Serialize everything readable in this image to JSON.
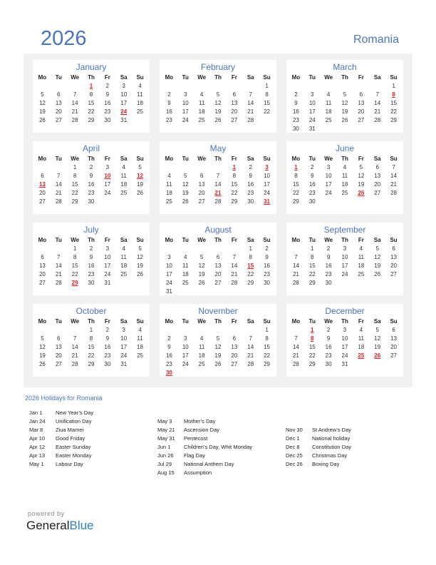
{
  "header": {
    "year": "2026",
    "country": "Romania"
  },
  "weekdays": [
    "Mo",
    "Tu",
    "We",
    "Th",
    "Fr",
    "Sa",
    "Su"
  ],
  "months": [
    {
      "name": "January",
      "offset": 3,
      "days": 31,
      "holidays": [
        1,
        24
      ]
    },
    {
      "name": "February",
      "offset": 6,
      "days": 28,
      "holidays": []
    },
    {
      "name": "March",
      "offset": 6,
      "days": 31,
      "holidays": [
        8
      ]
    },
    {
      "name": "April",
      "offset": 2,
      "days": 30,
      "holidays": [
        10,
        12,
        13
      ]
    },
    {
      "name": "May",
      "offset": 4,
      "days": 31,
      "holidays": [
        1,
        3,
        21,
        31
      ]
    },
    {
      "name": "June",
      "offset": 0,
      "days": 30,
      "holidays": [
        1,
        26
      ]
    },
    {
      "name": "July",
      "offset": 2,
      "days": 31,
      "holidays": [
        29
      ]
    },
    {
      "name": "August",
      "offset": 5,
      "days": 31,
      "holidays": [
        15
      ]
    },
    {
      "name": "September",
      "offset": 1,
      "days": 30,
      "holidays": []
    },
    {
      "name": "October",
      "offset": 3,
      "days": 31,
      "holidays": []
    },
    {
      "name": "November",
      "offset": 6,
      "days": 30,
      "holidays": [
        30
      ]
    },
    {
      "name": "December",
      "offset": 1,
      "days": 31,
      "holidays": [
        1,
        8,
        25,
        26
      ]
    }
  ],
  "holidays_title": "2026 Holidays for Romania",
  "holiday_columns": [
    [
      {
        "date": "Jan 1",
        "name": "New Year’s Day"
      },
      {
        "date": "Jan 24",
        "name": "Unification Day"
      },
      {
        "date": "Mar 8",
        "name": "Ziua Mamei"
      },
      {
        "date": "Apr 10",
        "name": "Good Friday"
      },
      {
        "date": "Apr 12",
        "name": "Easter Sunday"
      },
      {
        "date": "Apr 13",
        "name": "Easter Monday"
      },
      {
        "date": "May 1",
        "name": "Labour Day"
      }
    ],
    [
      {
        "date": "May 3",
        "name": "Mother’s Day"
      },
      {
        "date": "May 21",
        "name": "Ascension Day"
      },
      {
        "date": "May 31",
        "name": "Pentecost"
      },
      {
        "date": "Jun 1",
        "name": "Children’s Day, Whit Monday"
      },
      {
        "date": "Jun 26",
        "name": "Flag Day"
      },
      {
        "date": "Jul 29",
        "name": "National Anthem Day"
      },
      {
        "date": "Aug 15",
        "name": "Assumption"
      }
    ],
    [
      {
        "date": "Nov 30",
        "name": "St Andrew’s Day"
      },
      {
        "date": "Dec 1",
        "name": "National holiday"
      },
      {
        "date": "Dec 8",
        "name": "Constitution Day"
      },
      {
        "date": "Dec 25",
        "name": "Christmas Day"
      },
      {
        "date": "Dec 26",
        "name": "Boxing Day"
      }
    ]
  ],
  "footer": {
    "powered_by": "powered by",
    "brand_general": "General",
    "brand_blue": "Blue"
  }
}
